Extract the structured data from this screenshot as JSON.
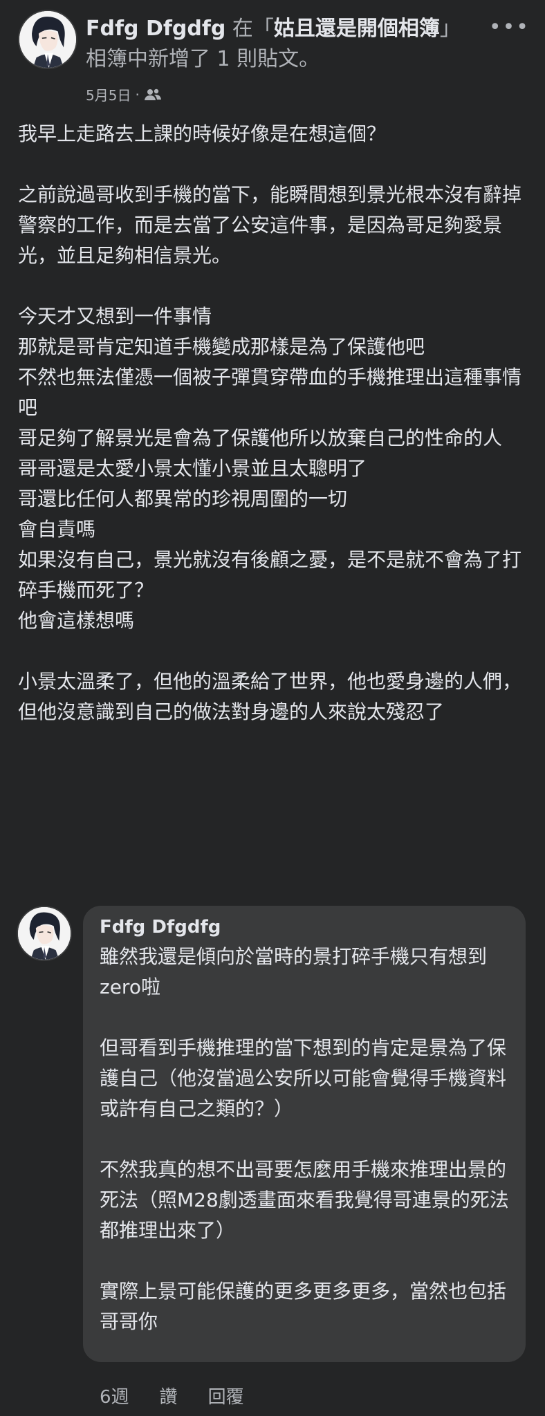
{
  "post": {
    "author": "Fdfg Dfgdfg",
    "action_prefix": "在「",
    "album": "姑且還是開個相簿",
    "action_suffix": "」相簿中新增了 1 則貼文。",
    "date": "5月5日",
    "separator": "·",
    "audience_icon": "friends-icon",
    "more_icon": "more-icon",
    "paragraphs": [
      [
        "我早上走路去上課的時候好像是在想這個？"
      ],
      [
        "之前說過哥收到手機的當下，能瞬間想到景光根本沒有辭掉警察的工作，而是去當了公安這件事，是因為哥足夠愛景光，並且足夠相信景光。"
      ],
      [
        "今天才又想到一件事情",
        "那就是哥肯定知道手機變成那樣是為了保護他吧",
        "不然也無法僅憑一個被子彈貫穿帶血的手機推理出這種事情吧",
        "哥足夠了解景光是會為了保護他所以放棄自己的性命的人",
        "哥哥還是太愛小景太懂小景並且太聰明了",
        "哥還比任何人都異常的珍視周圍的一切",
        "會自責嗎",
        "如果沒有自己，景光就沒有後顧之憂，是不是就不會為了打碎手機而死了？",
        "他會這樣想嗎"
      ],
      [
        "小景太溫柔了，但他的溫柔給了世界，他也愛身邊的人們，但他沒意識到自己的做法對身邊的人來說太殘忍了"
      ]
    ]
  },
  "comment": {
    "author": "Fdfg Dfgdfg",
    "paragraphs": [
      "雖然我還是傾向於當時的景打碎手機只有想到zero啦",
      "但哥看到手機推理的當下想到的肯定是景為了保護自己（他沒當過公安所以可能會覺得手機資料或許有自己之類的？）",
      "不然我真的想不出哥要怎麼用手機來推理出景的死法（照M28劇透畫面來看我覺得哥連景的死法都推理出來了）",
      "實際上景可能保護的更多更多更多，當然也包括哥哥你"
    ],
    "time": "6週",
    "like_label": "讚",
    "reply_label": "回覆"
  }
}
